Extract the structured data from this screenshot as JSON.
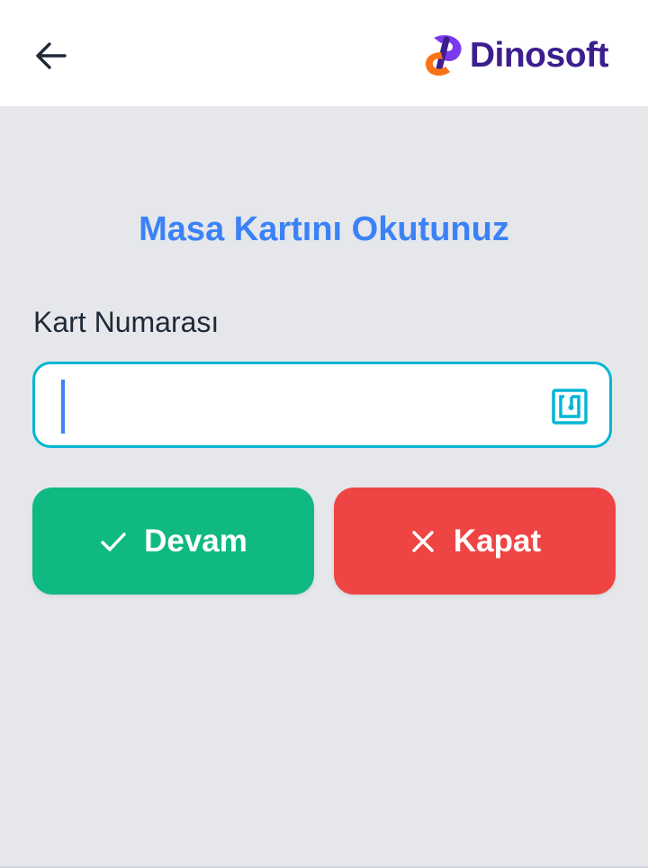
{
  "header": {
    "back_icon": "arrow-left-icon",
    "brand_name": "Dinosoft",
    "brand_colors": {
      "purple": "#3d1e8f",
      "orange": "#f97316",
      "violet": "#7c3aed"
    }
  },
  "main": {
    "title": "Masa Kartını Okutunuz",
    "field_label": "Kart Numarası",
    "card_input": {
      "value": "",
      "placeholder": "",
      "icon": "nfc-icon"
    }
  },
  "actions": {
    "continue_label": "Devam",
    "continue_icon": "check-icon",
    "continue_color": "#10b981",
    "close_label": "Kapat",
    "close_icon": "close-icon",
    "close_color": "#ef4444"
  },
  "colors": {
    "accent": "#3b82f6",
    "input_border": "#06b6d4",
    "background": "#e5e7eb"
  }
}
